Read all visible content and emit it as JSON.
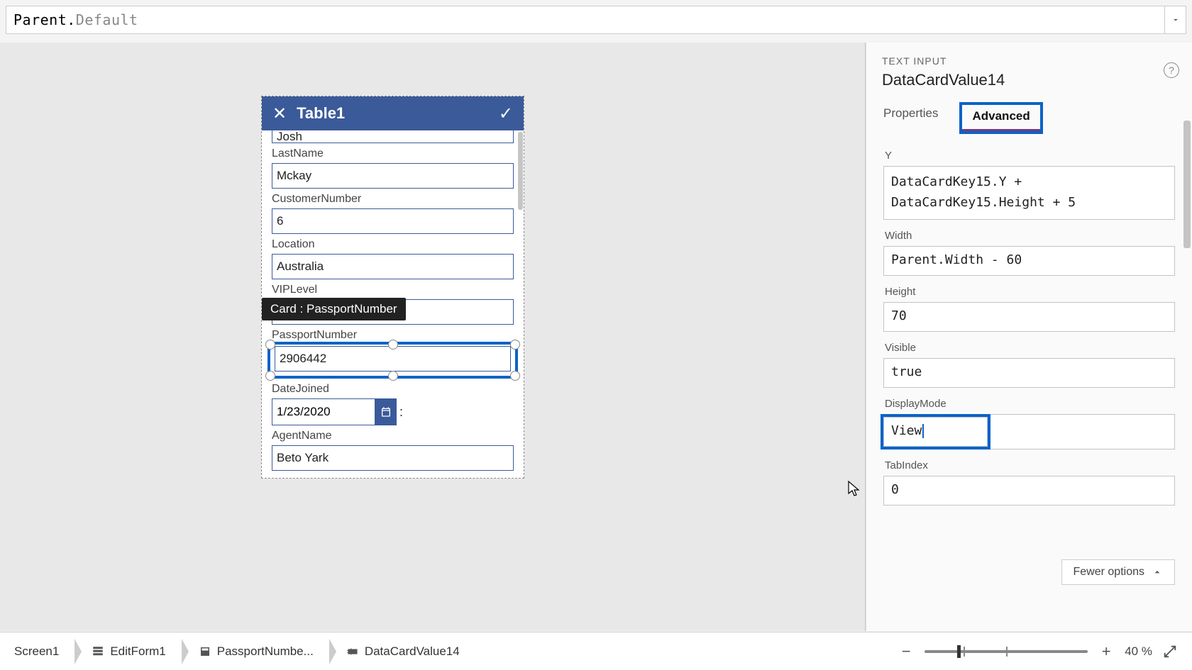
{
  "formula": {
    "prefix": "Parent",
    "dot": ".",
    "suffix": "Default"
  },
  "phone": {
    "title": "Table1",
    "tooltip": "Card : PassportNumber",
    "fields": {
      "firstName": {
        "value": "Josh"
      },
      "lastName": {
        "label": "LastName",
        "value": "Mckay"
      },
      "customerNumber": {
        "label": "CustomerNumber",
        "value": "6"
      },
      "location": {
        "label": "Location",
        "value": "Australia"
      },
      "vipLevel": {
        "label": "VIPLevel",
        "value": ""
      },
      "passportNumber": {
        "label": "PassportNumber",
        "value": "2906442"
      },
      "dateJoined": {
        "label": "DateJoined",
        "value": "1/23/2020"
      },
      "agentName": {
        "label": "AgentName",
        "value": "Beto Yark"
      }
    }
  },
  "panel": {
    "type": "TEXT INPUT",
    "name": "DataCardValue14",
    "tabs": {
      "properties": "Properties",
      "advanced": "Advanced"
    },
    "props": {
      "yLabel": "Y",
      "yValue": "DataCardKey15.Y + DataCardKey15.Height + 5",
      "widthLabel": "Width",
      "widthValue": "Parent.Width - 60",
      "heightLabel": "Height",
      "heightValue": "70",
      "visibleLabel": "Visible",
      "visibleValue": "true",
      "displayModeLabel": "DisplayMode",
      "displayModeValue": "View",
      "tabIndexLabel": "TabIndex",
      "tabIndexValue": "0"
    },
    "fewer": "Fewer options"
  },
  "breadcrumb": {
    "screen": "Screen1",
    "form": "EditForm1",
    "card": "PassportNumbe...",
    "value": "DataCardValue14"
  },
  "zoom": {
    "percent": "40",
    "unit": "%"
  }
}
